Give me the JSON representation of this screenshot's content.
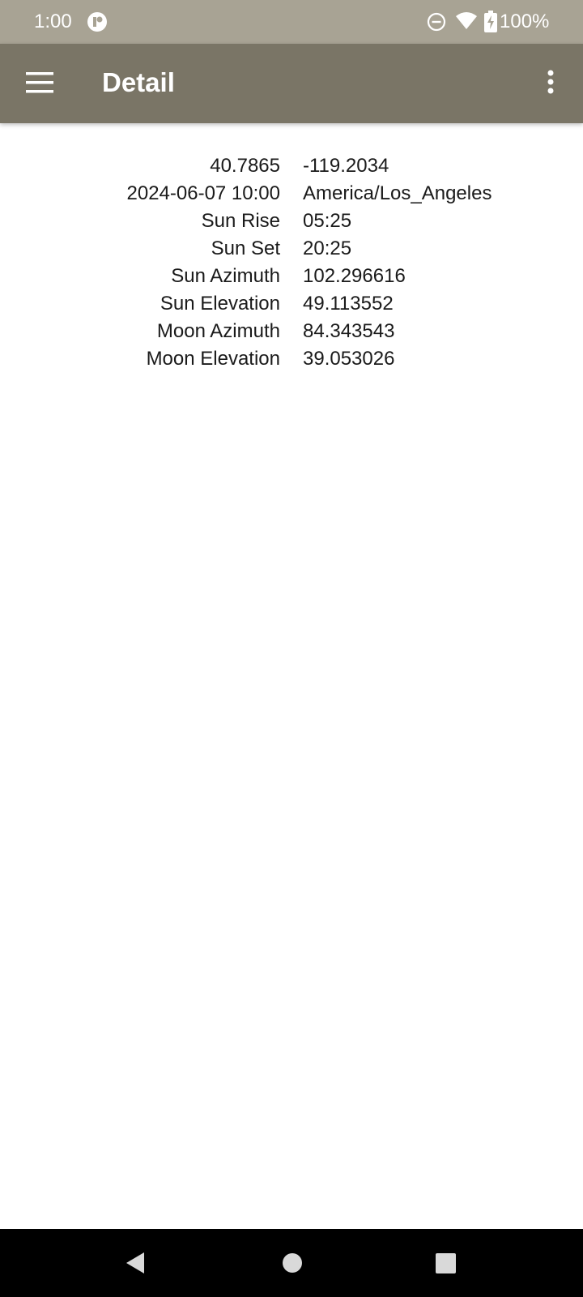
{
  "status_bar": {
    "time": "1:00",
    "battery": "100%",
    "icons": [
      "app-notification-icon",
      "do-not-disturb-icon",
      "wifi-icon",
      "battery-charging-icon"
    ]
  },
  "app_bar": {
    "title": "Detail",
    "menu_icon": "hamburger-menu-icon",
    "overflow_icon": "more-vert-icon"
  },
  "detail": {
    "rows": [
      {
        "label": "40.7865",
        "value": "-119.2034"
      },
      {
        "label": "2024-06-07 10:00",
        "value": "America/Los_Angeles"
      },
      {
        "label": "Sun Rise",
        "value": "05:25"
      },
      {
        "label": "Sun Set",
        "value": "20:25"
      },
      {
        "label": "Sun Azimuth",
        "value": "102.296616"
      },
      {
        "label": "Sun Elevation",
        "value": "49.113552"
      },
      {
        "label": "Moon Azimuth",
        "value": "84.343543"
      },
      {
        "label": "Moon Elevation",
        "value": "39.053026"
      }
    ]
  },
  "nav_bar": {
    "icons": [
      "back-icon",
      "home-icon",
      "recents-icon"
    ]
  },
  "colors": {
    "status_bar": "#a8a394",
    "app_bar": "#7a7566",
    "nav_bar": "#000000"
  }
}
